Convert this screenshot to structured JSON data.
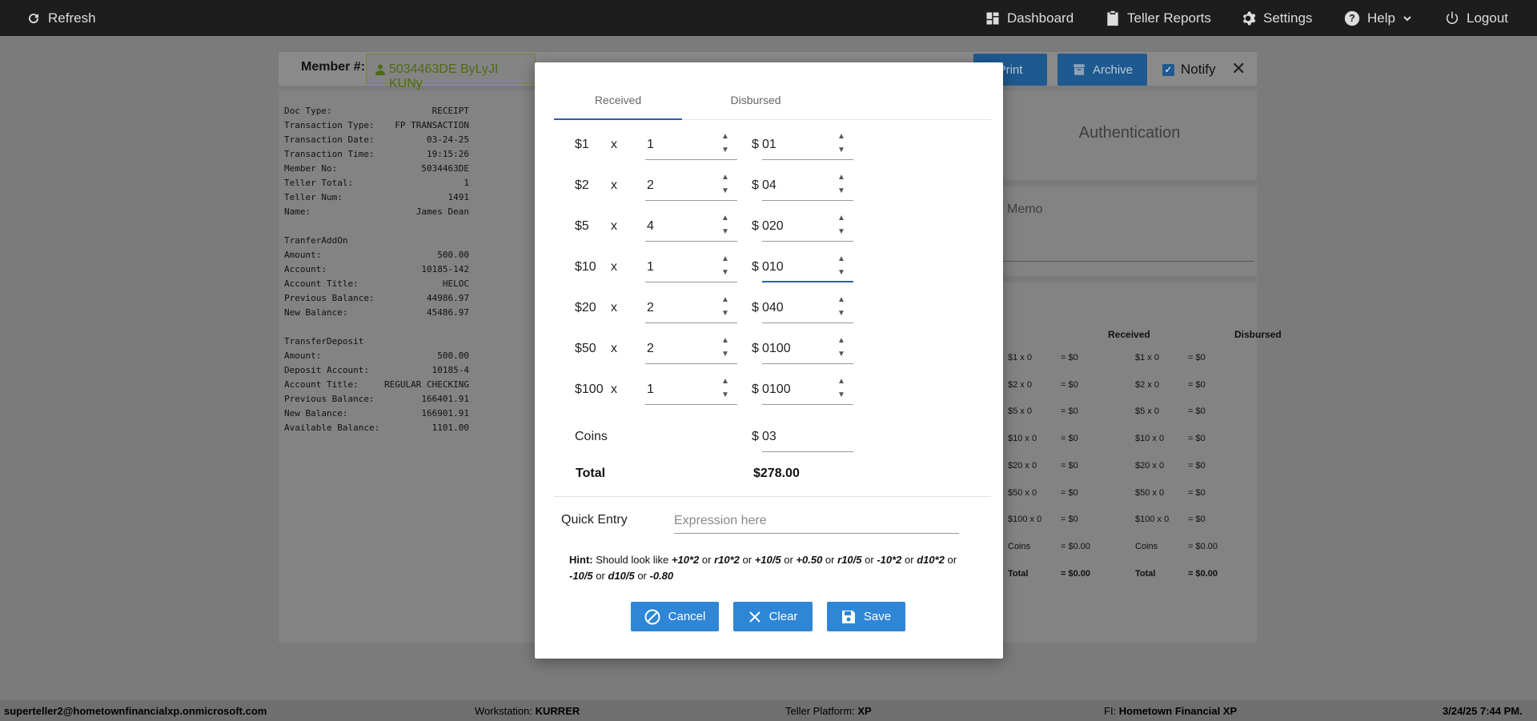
{
  "topbar": {
    "refresh": "Refresh",
    "dashboard": "Dashboard",
    "teller_reports": "Teller Reports",
    "settings": "Settings",
    "help": "Help",
    "logout": "Logout"
  },
  "member": {
    "label": "Member #:",
    "value": "5034463DE ByLyJI KUNy"
  },
  "actions": {
    "print": "Print",
    "archive": "Archive",
    "notify": "Notify"
  },
  "receipt": [
    {
      "k": "Doc Type:",
      "v": "RECEIPT"
    },
    {
      "k": "Transaction Type:",
      "v": "FP TRANSACTION"
    },
    {
      "k": "Transaction Date:",
      "v": "03-24-25"
    },
    {
      "k": "Transaction Time:",
      "v": "19:15:26"
    },
    {
      "k": "Member No:",
      "v": "5034463DE"
    },
    {
      "k": "Teller Total:",
      "v": "1"
    },
    {
      "k": "Teller Num:",
      "v": "1491"
    },
    {
      "k": "Name:",
      "v": "James Dean"
    },
    {
      "k": "",
      "v": ""
    },
    {
      "k": "TranferAddOn",
      "v": ""
    },
    {
      "k": "Amount:",
      "v": "500.00"
    },
    {
      "k": "Account:",
      "v": "10185-142"
    },
    {
      "k": "Account Title:",
      "v": "HELOC"
    },
    {
      "k": "Previous Balance:",
      "v": "44986.97"
    },
    {
      "k": "New Balance:",
      "v": "45486.97"
    },
    {
      "k": "",
      "v": ""
    },
    {
      "k": "TransferDeposit",
      "v": ""
    },
    {
      "k": "Amount:",
      "v": "500.00"
    },
    {
      "k": "Deposit Account:",
      "v": "10185-4"
    },
    {
      "k": "Account Title:",
      "v": "REGULAR CHECKING"
    },
    {
      "k": "Previous Balance:",
      "v": "166401.91"
    },
    {
      "k": "New Balance:",
      "v": "166901.91"
    },
    {
      "k": "Available Balance:",
      "v": "1101.00"
    }
  ],
  "auth": {
    "title": "Authentication"
  },
  "memo": {
    "label": "Memo"
  },
  "summary": {
    "received_header": "Received",
    "disbursed_header": "Disbursed",
    "received": [
      {
        "d": "$1 x 0",
        "t": "= $0"
      },
      {
        "d": "$2 x 0",
        "t": "= $0"
      },
      {
        "d": "$5 x 0",
        "t": "= $0"
      },
      {
        "d": "$10 x 0",
        "t": "= $0"
      },
      {
        "d": "$20 x 0",
        "t": "= $0"
      },
      {
        "d": "$50 x 0",
        "t": "= $0"
      },
      {
        "d": "$100 x 0",
        "t": "= $0"
      },
      {
        "d": "Coins",
        "t": "= $0.00"
      },
      {
        "d": "Total",
        "t": "= $0.00"
      }
    ],
    "disbursed": [
      {
        "d": "$1 x 0",
        "t": "= $0"
      },
      {
        "d": "$2 x 0",
        "t": "= $0"
      },
      {
        "d": "$5 x 0",
        "t": "= $0"
      },
      {
        "d": "$10 x 0",
        "t": "= $0"
      },
      {
        "d": "$20 x 0",
        "t": "= $0"
      },
      {
        "d": "$50 x 0",
        "t": "= $0"
      },
      {
        "d": "$100 x 0",
        "t": "= $0"
      },
      {
        "d": "Coins",
        "t": "= $0.00"
      },
      {
        "d": "Total",
        "t": "= $0.00"
      }
    ]
  },
  "modal": {
    "tabs": [
      "Received",
      "Disbursed"
    ],
    "active_tab": "Received",
    "x_symbol": "x",
    "dollar_symbol": "$",
    "denominations": [
      {
        "label": "$1",
        "count": "1",
        "amount": "01"
      },
      {
        "label": "$2",
        "count": "2",
        "amount": "04"
      },
      {
        "label": "$5",
        "count": "4",
        "amount": "020"
      },
      {
        "label": "$10",
        "count": "1",
        "amount": "010"
      },
      {
        "label": "$20",
        "count": "2",
        "amount": "040"
      },
      {
        "label": "$50",
        "count": "2",
        "amount": "0100"
      },
      {
        "label": "$100",
        "count": "1",
        "amount": "0100"
      }
    ],
    "coins_label": "Coins",
    "coins_amount": "03",
    "total_label": "Total",
    "total_value": "$278.00",
    "quick_entry_label": "Quick Entry",
    "quick_entry_placeholder": "Expression here",
    "hint_label": "Hint:",
    "hint_text": "Should look like",
    "hint_examples": [
      "+10*2",
      "r10*2",
      "+10/5",
      "+0.50",
      "r10/5",
      "-10*2",
      "d10*2",
      "-10/5",
      "d10/5",
      "-0.80"
    ],
    "hint_or": "or",
    "buttons": {
      "cancel": "Cancel",
      "clear": "Clear",
      "save": "Save"
    }
  },
  "status": {
    "user": "superteller2@hometownfinancialxp.onmicrosoft.com",
    "workstation_label": "Workstation:",
    "workstation": "KURRER",
    "platform_label": "Teller Platform:",
    "platform": "XP",
    "fi_label": "FI:",
    "fi": "Hometown Financial XP",
    "datetime": "3/24/25 7:44 PM."
  }
}
